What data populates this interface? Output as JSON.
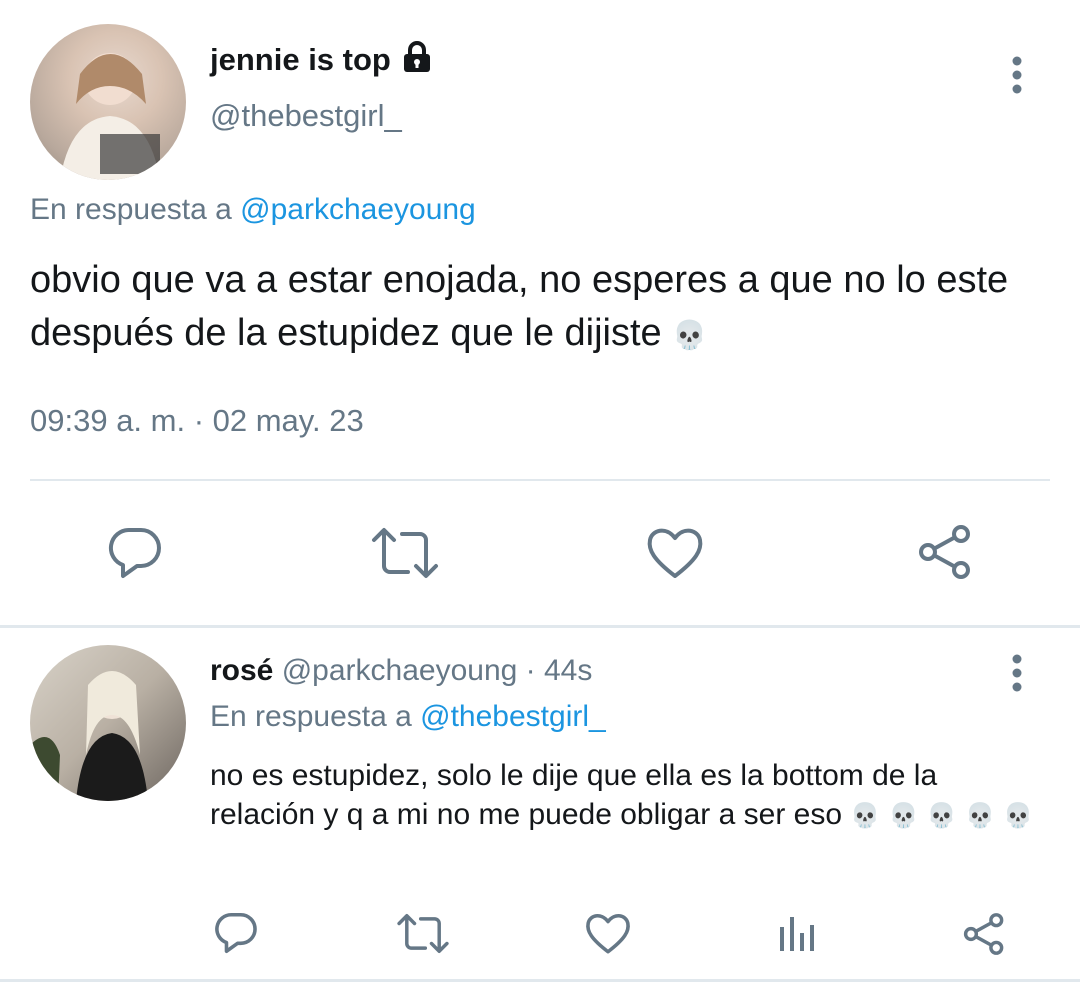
{
  "main_tweet": {
    "author_name": "jennie is top",
    "author_handle": "@thebestgirl_",
    "reply_prefix": "En respuesta a",
    "reply_to": "@parkchaeyoung",
    "text": "obvio que va a estar enojada, no esperes a que no lo este después de la estupidez que le dijiste",
    "emoji": "💀",
    "timestamp": "09:39 a. m. · 02 may. 23"
  },
  "reply_tweet": {
    "author_name": "rosé",
    "author_handle": "@parkchaeyoung",
    "time_ago": "· 44s",
    "reply_prefix": "En respuesta a",
    "reply_to": "@thebestgirl_",
    "text": "no es estupidez, solo le dije que ella es la bottom de la relación y q a mi no me puede obligar a ser eso",
    "emoji": "💀"
  },
  "icons": {
    "reply": "reply-icon",
    "retweet": "retweet-icon",
    "like": "heart-icon",
    "share": "share-icon",
    "analytics": "analytics-icon",
    "more": "more-vertical-icon",
    "lock": "lock-icon"
  },
  "colors": {
    "icon_gray": "#657786",
    "link_blue": "#1b95e0",
    "divider": "#e1e8ed"
  }
}
